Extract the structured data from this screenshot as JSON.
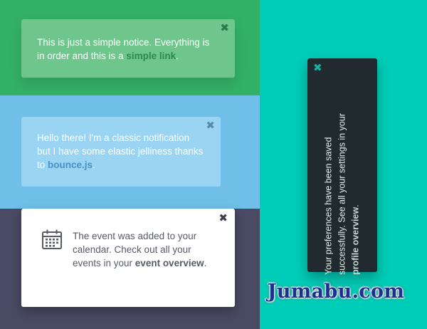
{
  "notices": {
    "green": {
      "close": "✖",
      "text_before": "This is just a simple notice. Everything is in order and this is a ",
      "link": "simple link",
      "text_after": "."
    },
    "blue": {
      "close": "✖",
      "text_before": "Hello there! I'm a classic notification but I have some elastic jelliness thanks to ",
      "link": "bounce.js",
      "text_after": "."
    },
    "white": {
      "close": "✖",
      "icon": "calendar-icon",
      "text_before": "The event was added to your calendar. Check out all your events in your ",
      "link": "event overview",
      "text_after": "."
    },
    "vertical": {
      "close": "✖",
      "text_before": "Your preferences have been saved successfully. See all your settings in your ",
      "link": "profile overview",
      "text_after": "."
    }
  },
  "watermark": "Jumabu.com",
  "colors": {
    "green_panel": "#33b068",
    "blue_panel": "#6fbfe9",
    "dark_panel": "#494a63",
    "teal_panel": "#00cdb8",
    "vertical_notice": "#212b2f"
  }
}
